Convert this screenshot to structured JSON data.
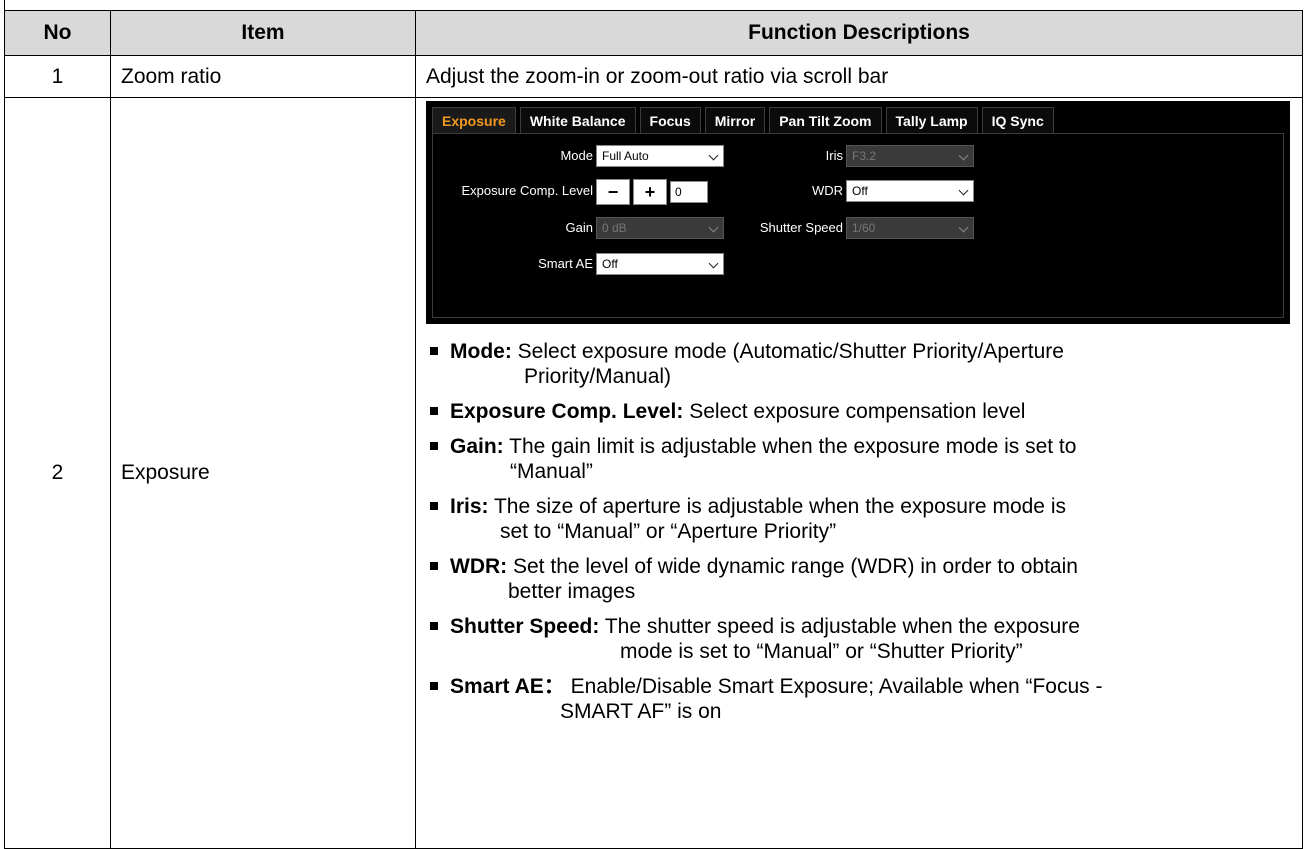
{
  "table": {
    "headers": {
      "no": "No",
      "item": "Item",
      "desc": "Function Descriptions"
    },
    "rows": [
      {
        "no": "1",
        "item": "Zoom ratio",
        "desc": "Adjust the zoom-in or zoom-out ratio via scroll bar"
      },
      {
        "no": "2",
        "item": "Exposure"
      }
    ]
  },
  "panel": {
    "tabs": [
      "Exposure",
      "White Balance",
      "Focus",
      "Mirror",
      "Pan Tilt Zoom",
      "Tally Lamp",
      "IQ Sync"
    ],
    "active_tab": "Exposure",
    "accent_color": "#f39a1e",
    "mode": {
      "label": "Mode",
      "value": "Full Auto"
    },
    "iris": {
      "label": "Iris",
      "value": "F3.2"
    },
    "exposure_comp": {
      "label": "Exposure Comp. Level",
      "minus": "−",
      "plus": "+",
      "value": "0"
    },
    "wdr": {
      "label": "WDR",
      "value": "Off"
    },
    "gain": {
      "label": "Gain",
      "value": "0 dB"
    },
    "shutter": {
      "label": "Shutter Speed",
      "value": "1/60"
    },
    "smart_ae": {
      "label": "Smart AE",
      "value": "Off"
    }
  },
  "bullets": [
    {
      "term": "Mode:",
      "line1": "Select exposure mode (Automatic/Shutter Priority/Aperture",
      "line2": "Priority/Manual)",
      "indent": 74
    },
    {
      "term": "Exposure Comp. Level:",
      "line1": "Select exposure compensation level",
      "line2": "",
      "indent": 0
    },
    {
      "term": "Gain:",
      "line1": "The gain limit is adjustable when the exposure mode is set to",
      "line2": "“Manual”",
      "indent": 60
    },
    {
      "term": "Iris:",
      "line1": "The size of aperture is adjustable when the exposure mode is",
      "line2": "set to “Manual” or “Aperture Priority”",
      "indent": 50
    },
    {
      "term": "WDR:",
      "line1": "Set the level of wide dynamic range (WDR) in order to obtain",
      "line2": "better images",
      "indent": 58
    },
    {
      "term": "Shutter Speed:",
      "line1": "The shutter speed is adjustable when the exposure",
      "line2": "mode is set to “Manual” or “Shutter Priority”",
      "indent": 170
    },
    {
      "term": "Smart AE：",
      "line1": "Enable/Disable Smart Exposure; Available when “Focus -",
      "line2": "SMART AF” is on",
      "indent": 110
    }
  ]
}
